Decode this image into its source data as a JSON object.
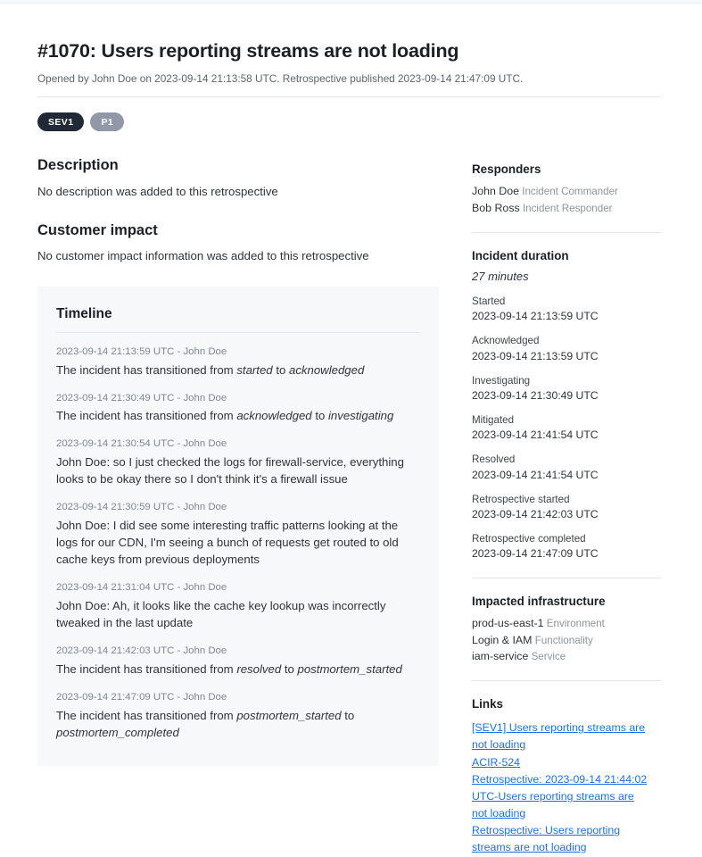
{
  "header": {
    "title": "#1070: Users reporting streams are not loading",
    "subtitle": "Opened by John Doe on 2023-09-14 21:13:58 UTC. Retrospective published 2023-09-14 21:47:09 UTC.",
    "badges": [
      {
        "label": "SEV1",
        "color": "#212936"
      },
      {
        "label": "P1",
        "color": "#9199a8"
      }
    ]
  },
  "main": {
    "description": {
      "heading": "Description",
      "text": "No description was added to this retrospective"
    },
    "customer_impact": {
      "heading": "Customer impact",
      "text": "No customer impact information was added to this retrospective"
    },
    "timeline": {
      "heading": "Timeline",
      "entries": [
        {
          "meta": "2023-09-14 21:13:59 UTC - John Doe",
          "parts": [
            {
              "t": "The incident has transitioned from ",
              "i": false
            },
            {
              "t": "started",
              "i": true
            },
            {
              "t": " to ",
              "i": false
            },
            {
              "t": "acknowledged",
              "i": true
            }
          ]
        },
        {
          "meta": "2023-09-14 21:30:49 UTC - John Doe",
          "parts": [
            {
              "t": "The incident has transitioned from ",
              "i": false
            },
            {
              "t": "acknowledged",
              "i": true
            },
            {
              "t": " to ",
              "i": false
            },
            {
              "t": "investigating",
              "i": true
            }
          ]
        },
        {
          "meta": "2023-09-14 21:30:54 UTC - John Doe",
          "parts": [
            {
              "t": "John Doe: so I just checked the logs for firewall-service, everything looks to be okay there so I don't think it's a firewall issue",
              "i": false
            }
          ]
        },
        {
          "meta": "2023-09-14 21:30:59 UTC - John Doe",
          "parts": [
            {
              "t": "John Doe: I did see some interesting traffic patterns looking at the logs for our CDN, I'm seeing a bunch of requests get routed to old cache keys from previous deployments",
              "i": false
            }
          ]
        },
        {
          "meta": "2023-09-14 21:31:04 UTC - John Doe",
          "parts": [
            {
              "t": "John Doe: Ah, it looks like the cache key lookup was incorrectly tweaked in the last update",
              "i": false
            }
          ]
        },
        {
          "meta": "2023-09-14 21:42:03 UTC - John Doe",
          "parts": [
            {
              "t": "The incident has transitioned from ",
              "i": false
            },
            {
              "t": "resolved",
              "i": true
            },
            {
              "t": " to ",
              "i": false
            },
            {
              "t": "postmortem_started",
              "i": true
            }
          ]
        },
        {
          "meta": "2023-09-14 21:47:09 UTC - John Doe",
          "parts": [
            {
              "t": "The incident has transitioned from ",
              "i": false
            },
            {
              "t": "postmortem_started",
              "i": true
            },
            {
              "t": " to ",
              "i": false
            },
            {
              "t": "postmortem_completed",
              "i": true
            }
          ]
        }
      ]
    }
  },
  "sidebar": {
    "responders": {
      "heading": "Responders",
      "people": [
        {
          "name": "John Doe",
          "role": "Incident Commander"
        },
        {
          "name": "Bob Ross",
          "role": "Incident Responder"
        }
      ]
    },
    "duration": {
      "heading": "Incident duration",
      "value": "27 minutes",
      "timestamps": [
        {
          "label": "Started",
          "value": "2023-09-14 21:13:59 UTC"
        },
        {
          "label": "Acknowledged",
          "value": "2023-09-14 21:13:59 UTC"
        },
        {
          "label": "Investigating",
          "value": "2023-09-14 21:30:49 UTC"
        },
        {
          "label": "Mitigated",
          "value": "2023-09-14 21:41:54 UTC"
        },
        {
          "label": "Resolved",
          "value": "2023-09-14 21:41:54 UTC"
        },
        {
          "label": "Retrospective started",
          "value": "2023-09-14 21:42:03 UTC"
        },
        {
          "label": "Retrospective completed",
          "value": "2023-09-14 21:47:09 UTC"
        }
      ]
    },
    "infrastructure": {
      "heading": "Impacted infrastructure",
      "items": [
        {
          "name": "prod-us-east-1",
          "kind": "Environment"
        },
        {
          "name": "Login & IAM",
          "kind": "Functionality"
        },
        {
          "name": "iam-service",
          "kind": "Service"
        }
      ]
    },
    "links": {
      "heading": "Links",
      "color": "#1a73e8",
      "items": [
        "[SEV1] Users reporting streams are not loading",
        "ACIR-524",
        "Retrospective: 2023-09-14 21:44:02 UTC-Users reporting streams are not loading",
        "Retrospective: Users reporting streams are not loading"
      ]
    }
  }
}
